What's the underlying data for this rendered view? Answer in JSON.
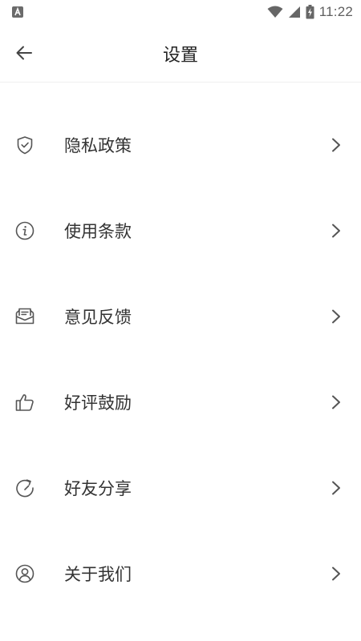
{
  "status_bar": {
    "time": "11:22",
    "notification_icon": "a-notification-icon",
    "icons": [
      "wifi-icon",
      "cellular-signal-icon",
      "battery-charging-icon"
    ]
  },
  "header": {
    "title": "设置",
    "back_icon": "arrow-left-icon"
  },
  "menu": {
    "items": [
      {
        "label": "隐私政策",
        "icon": "shield-check-icon"
      },
      {
        "label": "使用条款",
        "icon": "info-circle-icon"
      },
      {
        "label": "意见反馈",
        "icon": "mail-open-icon"
      },
      {
        "label": "好评鼓励",
        "icon": "thumbs-up-icon"
      },
      {
        "label": "好友分享",
        "icon": "share-circular-icon"
      },
      {
        "label": "关于我们",
        "icon": "user-circle-icon"
      }
    ],
    "chevron_icon": "chevron-right-icon"
  },
  "colors": {
    "background": "#ffffff",
    "text_primary": "#333333",
    "title": "#222222",
    "icon": "#555555",
    "chevron": "#555555",
    "status_icons": "#666666"
  }
}
